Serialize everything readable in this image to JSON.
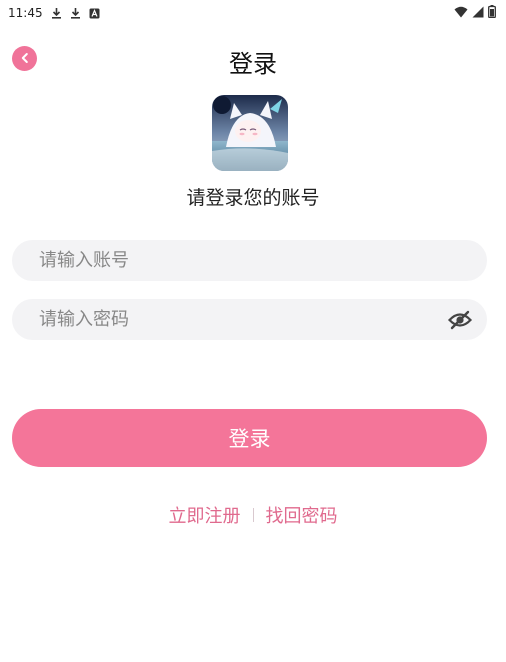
{
  "status_bar": {
    "time": "11:45",
    "left_icons": [
      "download-icon",
      "download-icon",
      "a-notification-icon"
    ],
    "right_icons": [
      "wifi-icon",
      "signal-icon",
      "battery-icon"
    ]
  },
  "header": {
    "title": "登录",
    "back_icon": "chevron-left-icon"
  },
  "profile": {
    "subtitle": "请登录您的账号"
  },
  "form": {
    "account_placeholder": "请输入账号",
    "password_placeholder": "请输入密码",
    "password_toggle_icon": "eye-off-icon",
    "login_label": "登录"
  },
  "links": {
    "register": "立即注册",
    "recover": "找回密码"
  },
  "colors": {
    "accent": "#f47599",
    "back_button": "#f07399",
    "link": "#e06a8e",
    "field_bg": "#f3f3f5"
  }
}
